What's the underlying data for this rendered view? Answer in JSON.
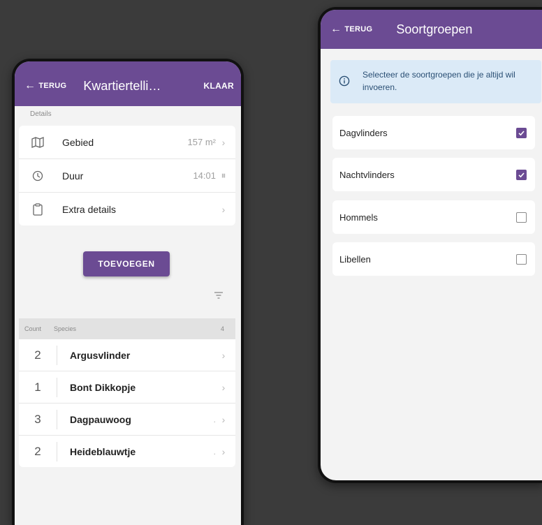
{
  "colors": {
    "accent": "#6b4b93",
    "info_bg": "#dbeaf7",
    "background": "#3b3b3b"
  },
  "left_screen": {
    "header": {
      "back_label": "TERUG",
      "title": "Kwartiertelli…",
      "done_label": "KLAAR"
    },
    "details_label": "Details",
    "details": [
      {
        "icon": "map-icon",
        "label": "Gebied",
        "value": "157 m²",
        "end": "›"
      },
      {
        "icon": "clock-icon",
        "label": "Duur",
        "value": "14:01",
        "end": "⏸"
      },
      {
        "icon": "clipboard-icon",
        "label": "Extra details",
        "value": "",
        "end": "›"
      }
    ],
    "add_button": "TOEVOEGEN",
    "list_header": {
      "count": "Count",
      "species": "Species",
      "total": "4"
    },
    "species": [
      {
        "count": "2",
        "name": "Argusvlinder",
        "dots": ""
      },
      {
        "count": "1",
        "name": "Bont Dikkopje",
        "dots": ""
      },
      {
        "count": "3",
        "name": "Dagpauwoog",
        "dots": "."
      },
      {
        "count": "2",
        "name": "Heideblauwtje",
        "dots": "."
      }
    ]
  },
  "right_screen": {
    "header": {
      "back_label": "TERUG",
      "title": "Soortgroepen"
    },
    "info_text": "Selecteer de soortgroepen die je altijd wil invoeren.",
    "groups": [
      {
        "label": "Dagvlinders",
        "checked": true
      },
      {
        "label": "Nachtvlinders",
        "checked": true
      },
      {
        "label": "Hommels",
        "checked": false
      },
      {
        "label": "Libellen",
        "checked": false
      }
    ]
  }
}
